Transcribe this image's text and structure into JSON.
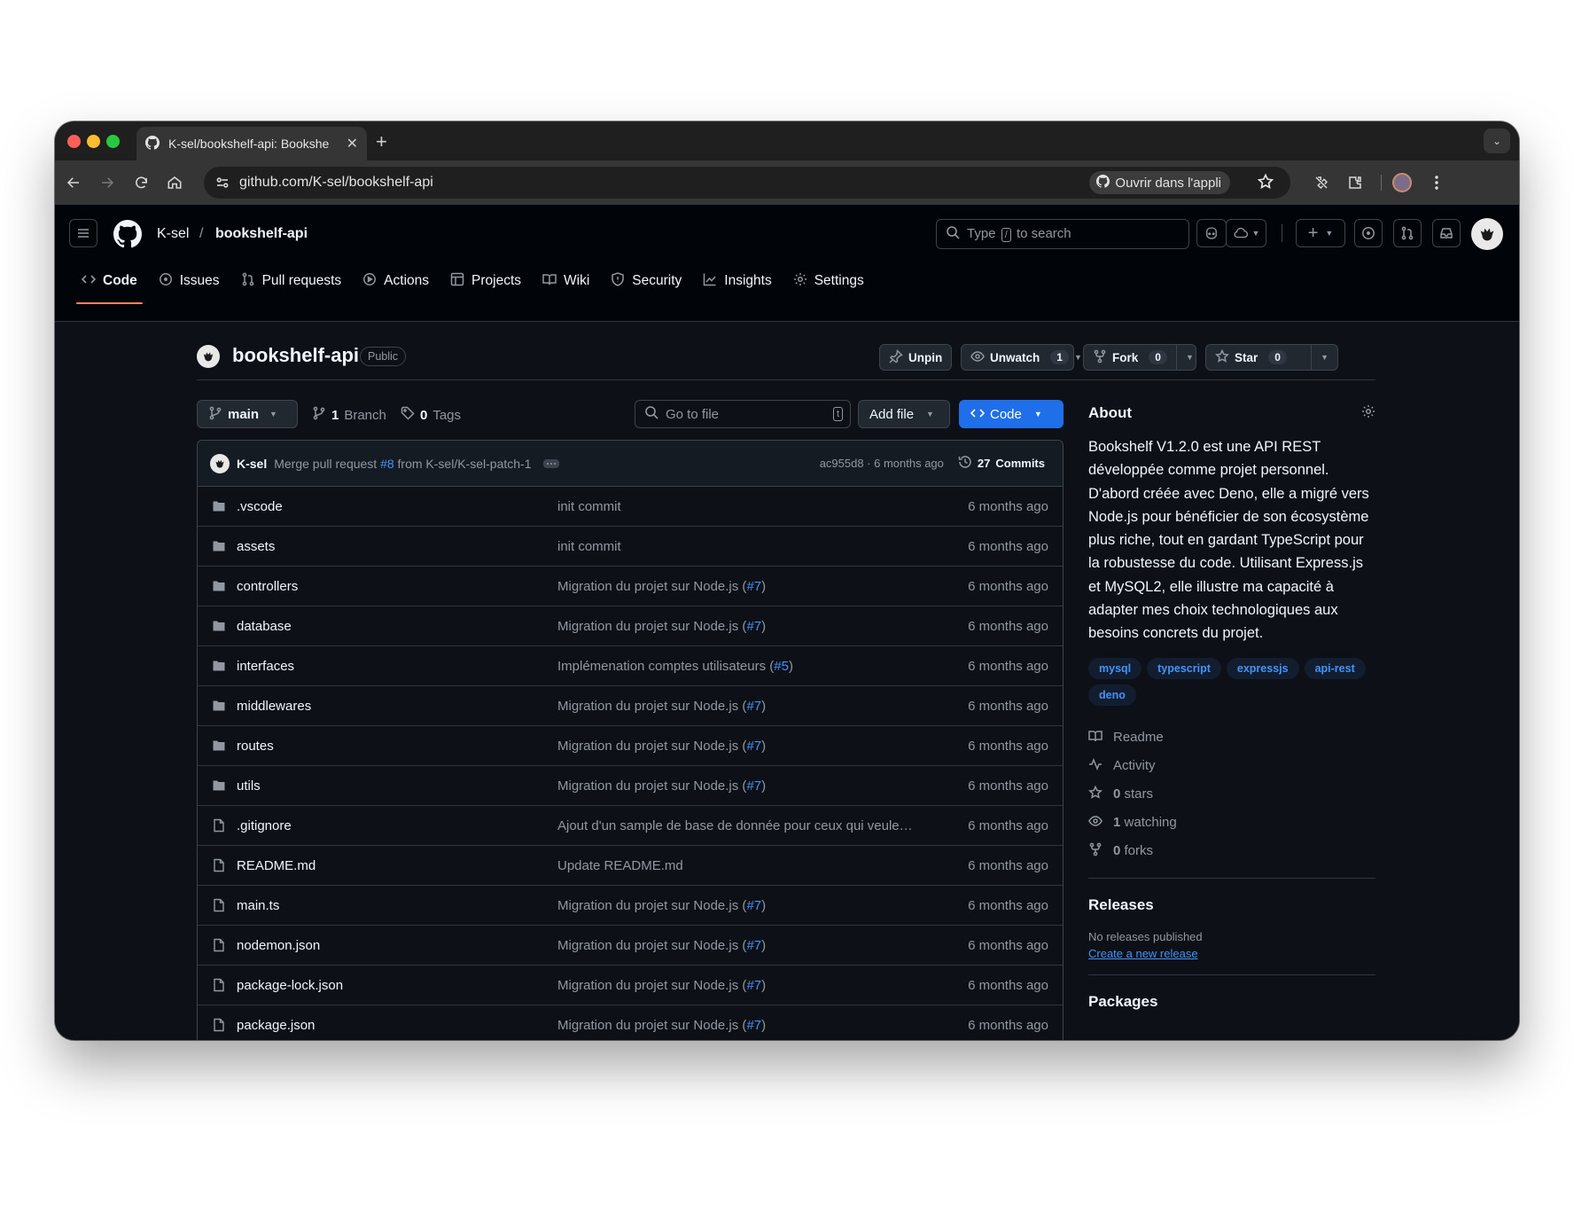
{
  "browser": {
    "tab_title": "K-sel/bookshelf-api: Bookshe",
    "url": "github.com/K-sel/bookshelf-api",
    "open_in_app": "Ouvrir dans l'appli"
  },
  "header": {
    "owner": "K-sel",
    "separator": "/",
    "repo": "bookshelf-api",
    "search_prefix": "Type",
    "search_key": "/",
    "search_suffix": "to search"
  },
  "nav": {
    "tabs": [
      {
        "label": "Code",
        "icon": "code-icon"
      },
      {
        "label": "Issues",
        "icon": "issue-icon"
      },
      {
        "label": "Pull requests",
        "icon": "pull-request-icon"
      },
      {
        "label": "Actions",
        "icon": "play-icon"
      },
      {
        "label": "Projects",
        "icon": "table-icon"
      },
      {
        "label": "Wiki",
        "icon": "book-icon"
      },
      {
        "label": "Security",
        "icon": "shield-icon"
      },
      {
        "label": "Insights",
        "icon": "graph-icon"
      },
      {
        "label": "Settings",
        "icon": "gear-icon"
      }
    ]
  },
  "repo": {
    "name": "bookshelf-api",
    "visibility": "Public",
    "unpin": "Unpin",
    "unwatch": "Unwatch",
    "watch_count": "1",
    "fork": "Fork",
    "fork_count": "0",
    "star": "Star",
    "star_count": "0"
  },
  "branchbar": {
    "branch": "main",
    "branch_count": "1",
    "branch_label": "Branch",
    "tag_count": "0",
    "tag_label": "Tags",
    "goto_placeholder": "Go to file",
    "goto_key": "t",
    "add_file": "Add file",
    "code": "Code"
  },
  "commit": {
    "author": "K-sel",
    "message_prefix": "Merge pull request",
    "pr_ref": "#8",
    "message_suffix": "from K-sel/K-sel-patch-1",
    "hash_time": "ac955d8 · 6 months ago",
    "commits_count": "27",
    "commits_label": "Commits"
  },
  "files": [
    {
      "type": "dir",
      "name": ".vscode",
      "msg": "init commit",
      "ref": "",
      "tail": "",
      "when": "6 months ago"
    },
    {
      "type": "dir",
      "name": "assets",
      "msg": "init commit",
      "ref": "",
      "tail": "",
      "when": "6 months ago"
    },
    {
      "type": "dir",
      "name": "controllers",
      "msg": "Migration du projet sur Node.js (",
      "ref": "#7",
      "tail": ")",
      "when": "6 months ago"
    },
    {
      "type": "dir",
      "name": "database",
      "msg": "Migration du projet sur Node.js (",
      "ref": "#7",
      "tail": ")",
      "when": "6 months ago"
    },
    {
      "type": "dir",
      "name": "interfaces",
      "msg": "Implémenation comptes utilisateurs (",
      "ref": "#5",
      "tail": ")",
      "when": "6 months ago"
    },
    {
      "type": "dir",
      "name": "middlewares",
      "msg": "Migration du projet sur Node.js (",
      "ref": "#7",
      "tail": ")",
      "when": "6 months ago"
    },
    {
      "type": "dir",
      "name": "routes",
      "msg": "Migration du projet sur Node.js (",
      "ref": "#7",
      "tail": ")",
      "when": "6 months ago"
    },
    {
      "type": "dir",
      "name": "utils",
      "msg": "Migration du projet sur Node.js (",
      "ref": "#7",
      "tail": ")",
      "when": "6 months ago"
    },
    {
      "type": "file",
      "name": ".gitignore",
      "msg": "Ajout d'un sample de base de donnée pour ceux qui veule…",
      "ref": "",
      "tail": "",
      "when": "6 months ago"
    },
    {
      "type": "file",
      "name": "README.md",
      "msg": "Update README.md",
      "ref": "",
      "tail": "",
      "when": "6 months ago"
    },
    {
      "type": "file",
      "name": "main.ts",
      "msg": "Migration du projet sur Node.js (",
      "ref": "#7",
      "tail": ")",
      "when": "6 months ago"
    },
    {
      "type": "file",
      "name": "nodemon.json",
      "msg": "Migration du projet sur Node.js (",
      "ref": "#7",
      "tail": ")",
      "when": "6 months ago"
    },
    {
      "type": "file",
      "name": "package-lock.json",
      "msg": "Migration du projet sur Node.js (",
      "ref": "#7",
      "tail": ")",
      "when": "6 months ago"
    },
    {
      "type": "file",
      "name": "package.json",
      "msg": "Migration du projet sur Node.js (",
      "ref": "#7",
      "tail": ")",
      "when": "6 months ago"
    }
  ],
  "about": {
    "title": "About",
    "description": "Bookshelf V1.2.0 est une API REST développée comme projet personnel. D'abord créée avec Deno, elle a migré vers Node.js pour bénéficier de son écosystème plus riche, tout en gardant TypeScript pour la robustesse du code. Utilisant Express.js et MySQL2, elle illustre ma capacité à adapter mes choix technologiques aux besoins concrets du projet.",
    "topics": [
      "mysql",
      "typescript",
      "expressjs",
      "api-rest",
      "deno"
    ],
    "readme": "Readme",
    "activity": "Activity",
    "stars_count": "0",
    "stars_label": "stars",
    "watching_count": "1",
    "watching_label": "watching",
    "forks_count": "0",
    "forks_label": "forks",
    "releases_title": "Releases",
    "no_releases": "No releases published",
    "create_release": "Create a new release",
    "packages_title": "Packages"
  },
  "colors": {
    "accent_blue": "#4493f8",
    "code_button": "#1f6feb",
    "active_underline": "#f78166"
  }
}
